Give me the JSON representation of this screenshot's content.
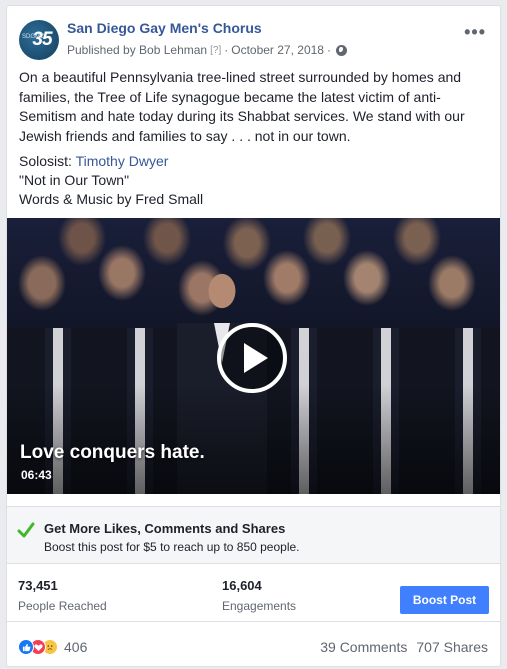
{
  "post": {
    "page_name": "San Diego Gay Men's Chorus",
    "avatar_text": "35",
    "avatar_sub": "SDGMC",
    "published_by": "Published by Bob Lehman",
    "help_marker": "[?]",
    "separator": "·",
    "date": "October 27, 2018",
    "more_label": "•••",
    "body": "On a beautiful Pennsylvania tree-lined street surrounded by homes and families, the Tree of Life synagogue became the latest victim of anti-Semitism and hate today during its Shabbat services. We stand with our Jewish friends and families to say . . . not in our town.",
    "soloist_label": "Solosist:",
    "soloist_name": "Timothy Dwyer",
    "song_title": "\"Not in Our Town\"",
    "song_credits": "Words & Music by Fred Small"
  },
  "video": {
    "title": "Love conquers hate.",
    "duration": "06:43"
  },
  "boost_promo": {
    "title": "Get More Likes, Comments and Shares",
    "subtitle": "Boost this post for $5 to reach up to 850 people."
  },
  "stats": {
    "reached_value": "73,451",
    "reached_label": "People Reached",
    "engagements_value": "16,604",
    "engagements_label": "Engagements",
    "boost_button": "Boost Post"
  },
  "footer": {
    "reaction_count": "406",
    "comments": "39 Comments",
    "shares": "707 Shares"
  },
  "colors": {
    "link": "#365899",
    "boost_button": "#4080ff",
    "check": "#42b72a"
  }
}
